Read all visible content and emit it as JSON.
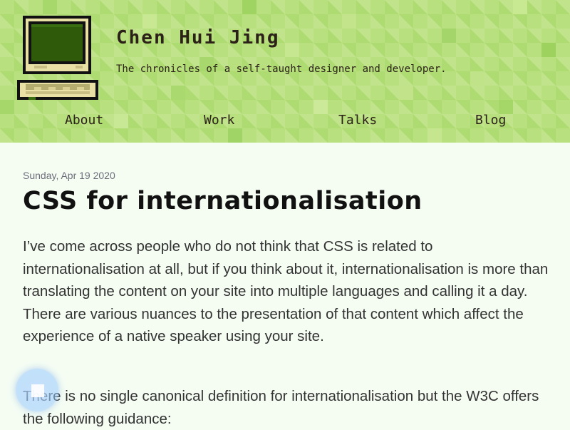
{
  "header": {
    "site_title": "Chen Hui Jing",
    "tagline": "The chronicles of a self-taught designer and developer."
  },
  "nav": {
    "items": [
      {
        "label": "About"
      },
      {
        "label": "Work"
      },
      {
        "label": "Talks"
      },
      {
        "label": "Blog"
      }
    ]
  },
  "post": {
    "date": "Sunday, Apr 19 2020",
    "title": "CSS for internationalisation",
    "paragraphs": [
      "I’ve come across people who do not think that CSS is related to internationalisation at all, but if you think about it, internationalisation is more than translating the content on your site into multiple languages and calling it a day. There are various nuances to the presentation of that content which affect the experience of a native speaker using your site.",
      "There is no single canonical definition for internationalisation but the W3C offers the following guidance:"
    ]
  },
  "colors": {
    "header_green": "#b9e07e",
    "page_bg": "#f5fdf3",
    "text_dark": "#2b2118",
    "body_text": "#333333",
    "date_gray": "#6c6d7a",
    "screen_green": "#2e5a09",
    "monitor_beige": "#e9e0a6"
  },
  "icons": {
    "logo": "retro-computer-icon",
    "cursor": "touch-cursor-indicator"
  }
}
